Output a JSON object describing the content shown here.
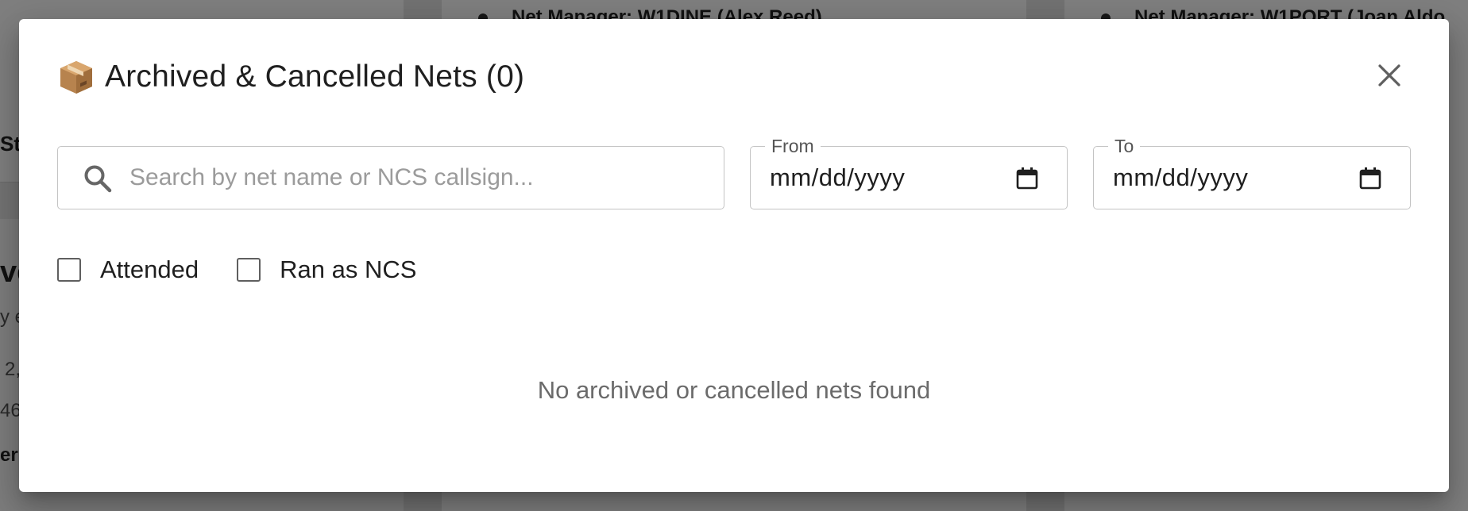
{
  "background": {
    "net_manager_left": "Net Manager: W1DINE (Alex Reed)",
    "net_manager_right": "Net Manager: W1PORT (Joan Aldo",
    "fragments": [
      "St",
      "ve",
      "y e",
      "2,",
      "46",
      "er"
    ]
  },
  "dialog": {
    "title_icon": "package-icon",
    "title": "Archived & Cancelled Nets (0)",
    "close_icon": "close-icon",
    "search": {
      "icon": "search-icon",
      "placeholder": "Search by net name or NCS callsign...",
      "value": ""
    },
    "date_from": {
      "label": "From",
      "value": "mm/dd/yyyy",
      "icon": "calendar-icon"
    },
    "date_to": {
      "label": "To",
      "value": "mm/dd/yyyy",
      "icon": "calendar-icon"
    },
    "filters": [
      {
        "label": "Attended",
        "checked": false
      },
      {
        "label": "Ran as NCS",
        "checked": false
      }
    ],
    "empty_message": "No archived or cancelled nets found"
  }
}
